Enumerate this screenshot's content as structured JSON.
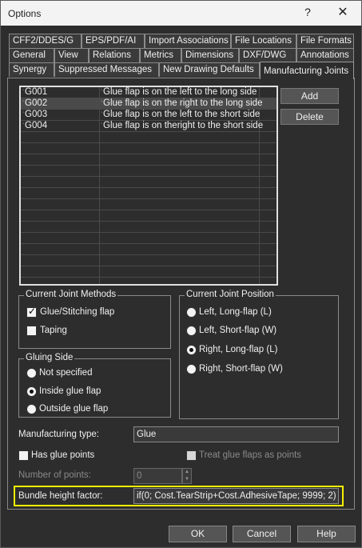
{
  "window": {
    "title": "Options",
    "help_glyph": "?",
    "close_glyph": "✕"
  },
  "tabs": {
    "row1": [
      "CFF2/DDES/G",
      "EPS/PDF/AI",
      "Import Associations",
      "File Locations",
      "File Formats"
    ],
    "row2": [
      "General",
      "View",
      "Relations",
      "Metrics",
      "Dimensions",
      "DXF/DWG",
      "Annotations"
    ],
    "row3": [
      "Synergy",
      "Suppressed Messages",
      "New Drawing Defaults",
      "Manufacturing Joints"
    ],
    "active": "Manufacturing Joints"
  },
  "joints": [
    {
      "code": "G001",
      "description": "Glue flap is on the left to the long side"
    },
    {
      "code": "G002",
      "description": "Glue flap is on the right to the long side"
    },
    {
      "code": "G003",
      "description": "Glue flap is on the left to the short side"
    },
    {
      "code": "G004",
      "description": "Glue flap is on theright to the short side"
    }
  ],
  "grid_buttons": {
    "add": "Add",
    "delete": "Delete"
  },
  "current_joint_methods": {
    "legend": "Current Joint Methods",
    "glue_stitching": {
      "label": "Glue/Stitching flap",
      "checked": true
    },
    "taping": {
      "label": "Taping",
      "checked": false
    }
  },
  "gluing_side": {
    "legend": "Gluing Side",
    "options": [
      "Not specified",
      "Inside glue flap",
      "Outside glue flap"
    ],
    "selected": "Inside glue flap"
  },
  "current_joint_position": {
    "legend": "Current Joint Position",
    "options": [
      "Left, Long-flap (L)",
      "Left, Short-flap (W)",
      "Right, Long-flap (L)",
      "Right, Short-flap (W)"
    ],
    "selected": "Right, Long-flap (L)"
  },
  "manufacturing_type": {
    "label": "Manufacturing type:",
    "value": "Glue"
  },
  "has_glue_points": {
    "label": "Has glue points",
    "checked": false
  },
  "treat_glue_flaps": {
    "label": "Treat glue flaps as points",
    "checked": false
  },
  "number_of_points": {
    "label": "Number of points:",
    "value": "0"
  },
  "bundle_height": {
    "label": "Bundle height factor:",
    "value": "if(0; Cost.TearStrip+Cost.AdhesiveTape; 9999; 2)"
  },
  "footer": {
    "ok": "OK",
    "cancel": "Cancel",
    "help": "Help"
  }
}
